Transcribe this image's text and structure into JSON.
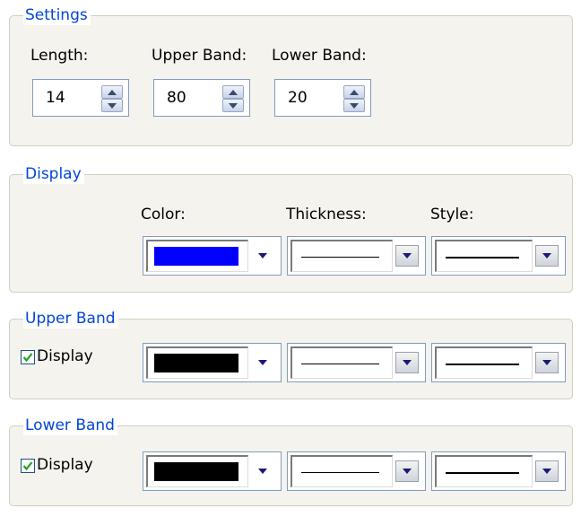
{
  "settings": {
    "title": "Settings",
    "length_label": "Length:",
    "upper_band_label": "Upper Band:",
    "lower_band_label": "Lower Band:",
    "length_value": "14",
    "upper_band_value": "80",
    "lower_band_value": "20"
  },
  "display_group": {
    "title": "Display",
    "color_label": "Color:",
    "thickness_label": "Thickness:",
    "style_label": "Style:",
    "color": "#0000ff",
    "thickness": "thin",
    "style": "solid"
  },
  "upper_band": {
    "title": "Upper Band",
    "display_label": "Display",
    "display_checked": true,
    "color": "#000000",
    "thickness": "thin",
    "style": "solid"
  },
  "lower_band": {
    "title": "Lower Band",
    "display_label": "Display",
    "display_checked": true,
    "color": "#000000",
    "thickness": "thin",
    "style": "solid"
  },
  "icons": {
    "spin_up": "triangle-up",
    "spin_down": "triangle-down",
    "dropdown": "triangle-down",
    "check": "checkmark"
  },
  "colors": {
    "group_title": "#0046d5",
    "group_border": "#d0d0bf",
    "field_border": "#7f9db9",
    "dropdown_arrow": "#1a1a7a",
    "checkmark": "#21a121"
  }
}
